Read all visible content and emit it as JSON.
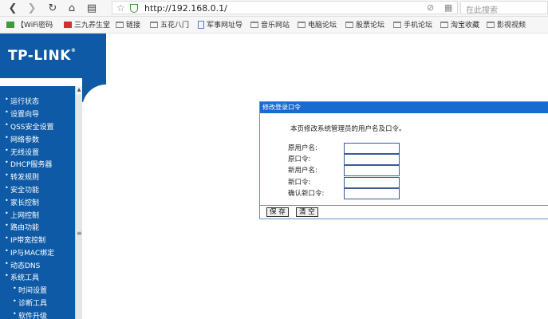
{
  "browser": {
    "url": "http://192.168.0.1/",
    "search_placeholder": "在此搜索"
  },
  "bookmarks": [
    {
      "label": "【WiFi密码",
      "icon": "wifi-icon"
    },
    {
      "label": "三九养生堂",
      "icon": "site-icon"
    },
    {
      "label": "链接",
      "icon": "folder-icon"
    },
    {
      "label": "五花八门",
      "icon": "folder-icon"
    },
    {
      "label": "军事网址导",
      "icon": "page-icon"
    },
    {
      "label": "音乐网站",
      "icon": "folder-icon"
    },
    {
      "label": "电脑论坛",
      "icon": "folder-icon"
    },
    {
      "label": "股票论坛",
      "icon": "folder-icon"
    },
    {
      "label": "手机论坛",
      "icon": "folder-icon"
    },
    {
      "label": "淘宝收藏",
      "icon": "folder-icon"
    },
    {
      "label": "影视视频",
      "icon": "folder-icon"
    }
  ],
  "router": {
    "logo": "TP-LINK",
    "menu": [
      {
        "label": "运行状态"
      },
      {
        "label": "设置向导"
      },
      {
        "label": "QSS安全设置"
      },
      {
        "label": "网络参数"
      },
      {
        "label": "无线设置"
      },
      {
        "label": "DHCP服务器"
      },
      {
        "label": "转发规则"
      },
      {
        "label": "安全功能"
      },
      {
        "label": "家长控制"
      },
      {
        "label": "上网控制"
      },
      {
        "label": "路由功能"
      },
      {
        "label": "IP带宽控制"
      },
      {
        "label": "IP与MAC绑定"
      },
      {
        "label": "动态DNS"
      },
      {
        "label": "系统工具"
      },
      {
        "label": "时间设置"
      },
      {
        "label": "诊断工具"
      },
      {
        "label": "软件升级"
      }
    ]
  },
  "form": {
    "title": "修改登录口令",
    "description": "本页修改系统管理员的用户名及口令。",
    "fields": [
      {
        "label": "原用户名:",
        "value": ""
      },
      {
        "label": "原口令:",
        "value": ""
      },
      {
        "label": "新用户名:",
        "value": ""
      },
      {
        "label": "新口令:",
        "value": ""
      },
      {
        "label": "确认新口令:",
        "value": ""
      }
    ],
    "save_label": "保 存",
    "clear_label": "清 空"
  }
}
